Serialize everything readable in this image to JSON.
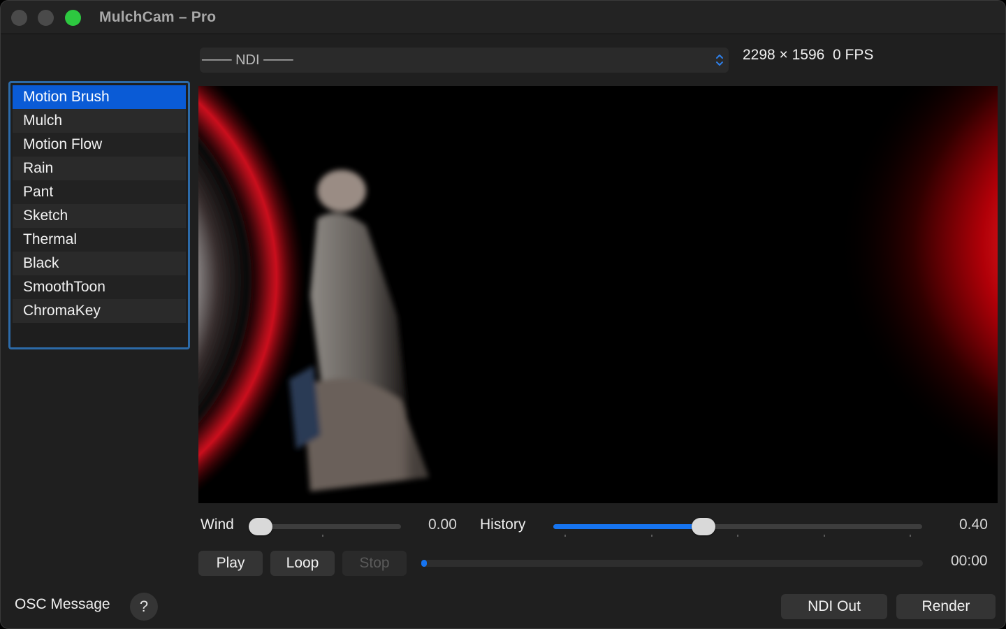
{
  "window": {
    "title": "MulchCam – Pro"
  },
  "source": {
    "selected": "─── NDI ───",
    "resolution": "2298 × 1596",
    "fps": "0 FPS"
  },
  "effects": {
    "items": [
      "Motion Brush",
      "Mulch",
      "Motion Flow",
      "Rain",
      "Pant",
      "Sketch",
      "Thermal",
      "Black",
      "SmoothToon",
      "ChromaKey"
    ],
    "selected": "Motion Brush"
  },
  "controls": {
    "wind": {
      "label": "Wind",
      "value": "0.00",
      "level": 0.0
    },
    "history": {
      "label": "History",
      "value": "0.40",
      "level": 0.4
    }
  },
  "transport": {
    "play": "Play",
    "loop": "Loop",
    "stop": "Stop",
    "time": "00:00",
    "progress": 0.0
  },
  "footer": {
    "osc_label": "OSC Message",
    "help": "?",
    "ndi_out": "NDI Out",
    "render": "Render"
  },
  "colors": {
    "accent": "#0a5bd6",
    "slider_fill": "#1674f0",
    "list_border": "#2c6aa8",
    "maximize": "#2dc840"
  }
}
